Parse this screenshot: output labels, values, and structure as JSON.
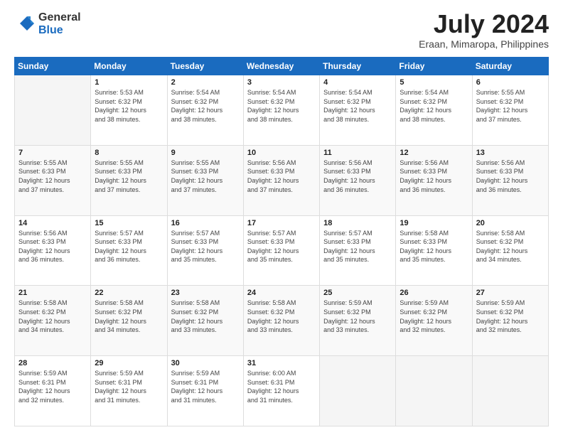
{
  "logo": {
    "general": "General",
    "blue": "Blue"
  },
  "title": {
    "month_year": "July 2024",
    "location": "Eraan, Mimaropa, Philippines"
  },
  "headers": [
    "Sunday",
    "Monday",
    "Tuesday",
    "Wednesday",
    "Thursday",
    "Friday",
    "Saturday"
  ],
  "weeks": [
    [
      {
        "day": "",
        "info": ""
      },
      {
        "day": "1",
        "info": "Sunrise: 5:53 AM\nSunset: 6:32 PM\nDaylight: 12 hours\nand 38 minutes."
      },
      {
        "day": "2",
        "info": "Sunrise: 5:54 AM\nSunset: 6:32 PM\nDaylight: 12 hours\nand 38 minutes."
      },
      {
        "day": "3",
        "info": "Sunrise: 5:54 AM\nSunset: 6:32 PM\nDaylight: 12 hours\nand 38 minutes."
      },
      {
        "day": "4",
        "info": "Sunrise: 5:54 AM\nSunset: 6:32 PM\nDaylight: 12 hours\nand 38 minutes."
      },
      {
        "day": "5",
        "info": "Sunrise: 5:54 AM\nSunset: 6:32 PM\nDaylight: 12 hours\nand 38 minutes."
      },
      {
        "day": "6",
        "info": "Sunrise: 5:55 AM\nSunset: 6:32 PM\nDaylight: 12 hours\nand 37 minutes."
      }
    ],
    [
      {
        "day": "7",
        "info": "Sunrise: 5:55 AM\nSunset: 6:33 PM\nDaylight: 12 hours\nand 37 minutes."
      },
      {
        "day": "8",
        "info": "Sunrise: 5:55 AM\nSunset: 6:33 PM\nDaylight: 12 hours\nand 37 minutes."
      },
      {
        "day": "9",
        "info": "Sunrise: 5:55 AM\nSunset: 6:33 PM\nDaylight: 12 hours\nand 37 minutes."
      },
      {
        "day": "10",
        "info": "Sunrise: 5:56 AM\nSunset: 6:33 PM\nDaylight: 12 hours\nand 37 minutes."
      },
      {
        "day": "11",
        "info": "Sunrise: 5:56 AM\nSunset: 6:33 PM\nDaylight: 12 hours\nand 36 minutes."
      },
      {
        "day": "12",
        "info": "Sunrise: 5:56 AM\nSunset: 6:33 PM\nDaylight: 12 hours\nand 36 minutes."
      },
      {
        "day": "13",
        "info": "Sunrise: 5:56 AM\nSunset: 6:33 PM\nDaylight: 12 hours\nand 36 minutes."
      }
    ],
    [
      {
        "day": "14",
        "info": "Sunrise: 5:56 AM\nSunset: 6:33 PM\nDaylight: 12 hours\nand 36 minutes."
      },
      {
        "day": "15",
        "info": "Sunrise: 5:57 AM\nSunset: 6:33 PM\nDaylight: 12 hours\nand 36 minutes."
      },
      {
        "day": "16",
        "info": "Sunrise: 5:57 AM\nSunset: 6:33 PM\nDaylight: 12 hours\nand 35 minutes."
      },
      {
        "day": "17",
        "info": "Sunrise: 5:57 AM\nSunset: 6:33 PM\nDaylight: 12 hours\nand 35 minutes."
      },
      {
        "day": "18",
        "info": "Sunrise: 5:57 AM\nSunset: 6:33 PM\nDaylight: 12 hours\nand 35 minutes."
      },
      {
        "day": "19",
        "info": "Sunrise: 5:58 AM\nSunset: 6:33 PM\nDaylight: 12 hours\nand 35 minutes."
      },
      {
        "day": "20",
        "info": "Sunrise: 5:58 AM\nSunset: 6:32 PM\nDaylight: 12 hours\nand 34 minutes."
      }
    ],
    [
      {
        "day": "21",
        "info": "Sunrise: 5:58 AM\nSunset: 6:32 PM\nDaylight: 12 hours\nand 34 minutes."
      },
      {
        "day": "22",
        "info": "Sunrise: 5:58 AM\nSunset: 6:32 PM\nDaylight: 12 hours\nand 34 minutes."
      },
      {
        "day": "23",
        "info": "Sunrise: 5:58 AM\nSunset: 6:32 PM\nDaylight: 12 hours\nand 33 minutes."
      },
      {
        "day": "24",
        "info": "Sunrise: 5:58 AM\nSunset: 6:32 PM\nDaylight: 12 hours\nand 33 minutes."
      },
      {
        "day": "25",
        "info": "Sunrise: 5:59 AM\nSunset: 6:32 PM\nDaylight: 12 hours\nand 33 minutes."
      },
      {
        "day": "26",
        "info": "Sunrise: 5:59 AM\nSunset: 6:32 PM\nDaylight: 12 hours\nand 32 minutes."
      },
      {
        "day": "27",
        "info": "Sunrise: 5:59 AM\nSunset: 6:32 PM\nDaylight: 12 hours\nand 32 minutes."
      }
    ],
    [
      {
        "day": "28",
        "info": "Sunrise: 5:59 AM\nSunset: 6:31 PM\nDaylight: 12 hours\nand 32 minutes."
      },
      {
        "day": "29",
        "info": "Sunrise: 5:59 AM\nSunset: 6:31 PM\nDaylight: 12 hours\nand 31 minutes."
      },
      {
        "day": "30",
        "info": "Sunrise: 5:59 AM\nSunset: 6:31 PM\nDaylight: 12 hours\nand 31 minutes."
      },
      {
        "day": "31",
        "info": "Sunrise: 6:00 AM\nSunset: 6:31 PM\nDaylight: 12 hours\nand 31 minutes."
      },
      {
        "day": "",
        "info": ""
      },
      {
        "day": "",
        "info": ""
      },
      {
        "day": "",
        "info": ""
      }
    ]
  ]
}
